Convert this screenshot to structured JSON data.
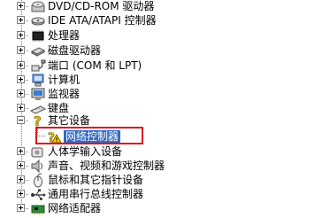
{
  "tree": {
    "items": [
      {
        "label": "DVD/CD-ROM 驱动器",
        "icon": "cdrom-drive-icon",
        "expanded": false
      },
      {
        "label": "IDE ATA/ATAPI 控制器",
        "icon": "ide-controller-icon",
        "expanded": false
      },
      {
        "label": "处理器",
        "icon": "processor-icon",
        "expanded": false
      },
      {
        "label": "磁盘驱动器",
        "icon": "disk-drive-icon",
        "expanded": false
      },
      {
        "label": "端口 (COM 和 LPT)",
        "icon": "port-icon",
        "expanded": false
      },
      {
        "label": "计算机",
        "icon": "computer-icon",
        "expanded": false
      },
      {
        "label": "监视器",
        "icon": "monitor-icon",
        "expanded": false
      },
      {
        "label": "键盘",
        "icon": "keyboard-icon",
        "expanded": false
      },
      {
        "label": "其它设备",
        "icon": "unknown-device-icon",
        "expanded": true
      },
      {
        "label": "网络控制器",
        "icon": "warning-device-icon",
        "child": true,
        "selected": true
      },
      {
        "label": "人体学输入设备",
        "icon": "hid-icon",
        "expanded": false
      },
      {
        "label": "声音、视频和游戏控制器",
        "icon": "sound-icon",
        "expanded": false
      },
      {
        "label": "鼠标和其它指针设备",
        "icon": "mouse-icon",
        "expanded": false
      },
      {
        "label": "通用串行总线控制器",
        "icon": "usb-icon",
        "expanded": false
      },
      {
        "label": "网络适配器",
        "icon": "network-adapter-icon",
        "expanded": false
      }
    ]
  },
  "colors": {
    "selection": "#316ac5",
    "highlight_border": "#e0141d"
  }
}
